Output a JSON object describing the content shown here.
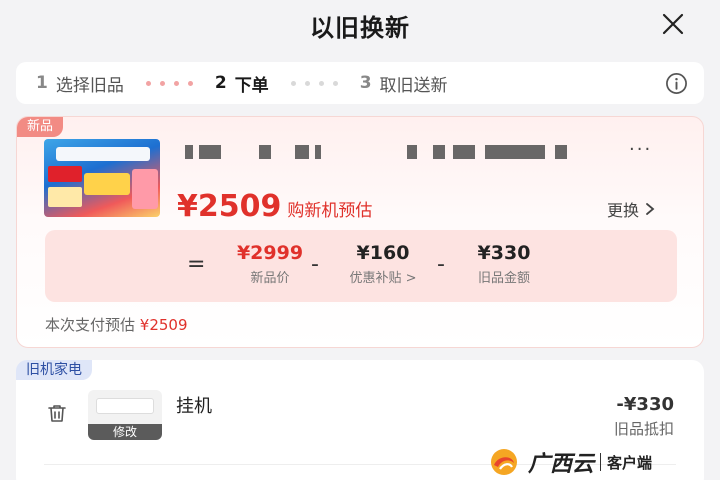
{
  "header": {
    "title": "以旧换新"
  },
  "steps": [
    {
      "num": "1",
      "label": "选择旧品"
    },
    {
      "num": "2",
      "label": "下单"
    },
    {
      "num": "3",
      "label": "取旧送新"
    }
  ],
  "new_product": {
    "tag": "新品",
    "more": "···",
    "price": "¥2509",
    "price_label": "购新机预估",
    "change_label": "更换",
    "calc": {
      "equals": "=",
      "minus": "-",
      "new_price_value": "¥2999",
      "new_price_label": "新品价",
      "subsidy_value": "¥160",
      "subsidy_label": "优惠补贴 >",
      "old_value": "¥330",
      "old_label": "旧品金额"
    },
    "pay_estimate_label": "本次支付预估",
    "pay_estimate_value": "¥2509"
  },
  "old_product": {
    "tag": "旧机家电",
    "edit_label": "修改",
    "name": "挂机",
    "price": "-¥330",
    "deduct_label": "旧品抵扣"
  },
  "watermark": {
    "brand": "广西云",
    "client": "客户端"
  },
  "colors": {
    "accent_red": "#e0312b",
    "calc_bg": "#fde3e1",
    "old_tag_bg": "#dfe6f8",
    "old_tag_text": "#2d4fa3"
  }
}
